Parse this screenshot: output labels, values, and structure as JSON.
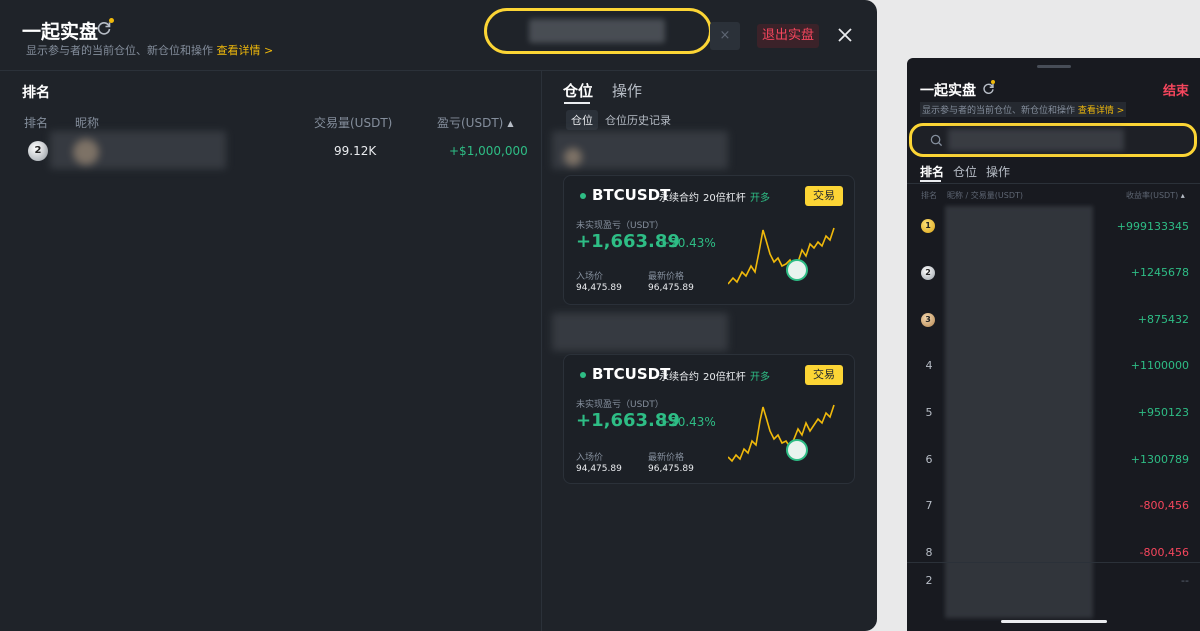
{
  "desktop": {
    "title": "一起实盘",
    "subtitle": "显示参与者的当前仓位、新仓位和操作",
    "details_link": "查看详情 >",
    "search_clear": "×",
    "exit_label": "退出实盘",
    "ranking": {
      "heading": "排名",
      "columns": {
        "rank": "排名",
        "nickname": "昵称",
        "volume": "交易量(USDT)",
        "pnl": "盈亏(USDT)"
      },
      "rows": [
        {
          "rank": "2",
          "volume": "99.12K",
          "pnl": "+$1,000,000"
        }
      ]
    },
    "tabs": [
      "仓位",
      "操作"
    ],
    "subtabs": [
      "仓位",
      "仓位历史记录"
    ],
    "positions": [
      {
        "symbol": "BTCUSDT",
        "contract": "永续合约",
        "leverage": "20倍杠杆",
        "side": "开多",
        "trade_label": "交易",
        "pnl_label": "未实现盈亏（USDT）",
        "pnl": "+1,663.89",
        "pct": "+20.43%",
        "entry_label": "入场价",
        "entry": "94,475.89",
        "last_label": "最新价格",
        "last": "96,475.89"
      },
      {
        "symbol": "BTCUSDT",
        "contract": "永续合约",
        "leverage": "20倍杠杆",
        "side": "开多",
        "trade_label": "交易",
        "pnl_label": "未实现盈亏（USDT）",
        "pnl": "+1,663.89",
        "pct": "+20.43%",
        "entry_label": "入场价",
        "entry": "94,475.89",
        "last_label": "最新价格",
        "last": "96,475.89"
      }
    ]
  },
  "mobile": {
    "title": "一起实盘",
    "end_label": "结束",
    "subtitle": "显示参与者的当前仓位、新仓位和操作",
    "details_link": "查看详情 >",
    "tabs": [
      "排名",
      "仓位",
      "操作"
    ],
    "columns": {
      "rank": "排名",
      "nickname_volume": "昵称 / 交易量(USDT)",
      "return": "收益率(USDT)"
    },
    "rows": [
      {
        "rank": "1",
        "value": "+999133345",
        "color": "#2ebd85"
      },
      {
        "rank": "2",
        "value": "+1245678",
        "color": "#2ebd85"
      },
      {
        "rank": "3",
        "value": "+875432",
        "color": "#2ebd85"
      },
      {
        "rank": "4",
        "value": "+1100000",
        "color": "#2ebd85"
      },
      {
        "rank": "5",
        "value": "+950123",
        "color": "#2ebd85"
      },
      {
        "rank": "6",
        "value": "+1300789",
        "color": "#2ebd85"
      },
      {
        "rank": "7",
        "value": "-800,456",
        "color": "#f6465d"
      },
      {
        "rank": "8",
        "value": "-800,456",
        "color": "#f6465d"
      },
      {
        "rank": "2",
        "value": "--",
        "color": "#5e6673"
      }
    ]
  },
  "colors": {
    "accent": "#fcd535",
    "up": "#2ebd85",
    "down": "#f6465d",
    "bg": "#1f2329"
  }
}
